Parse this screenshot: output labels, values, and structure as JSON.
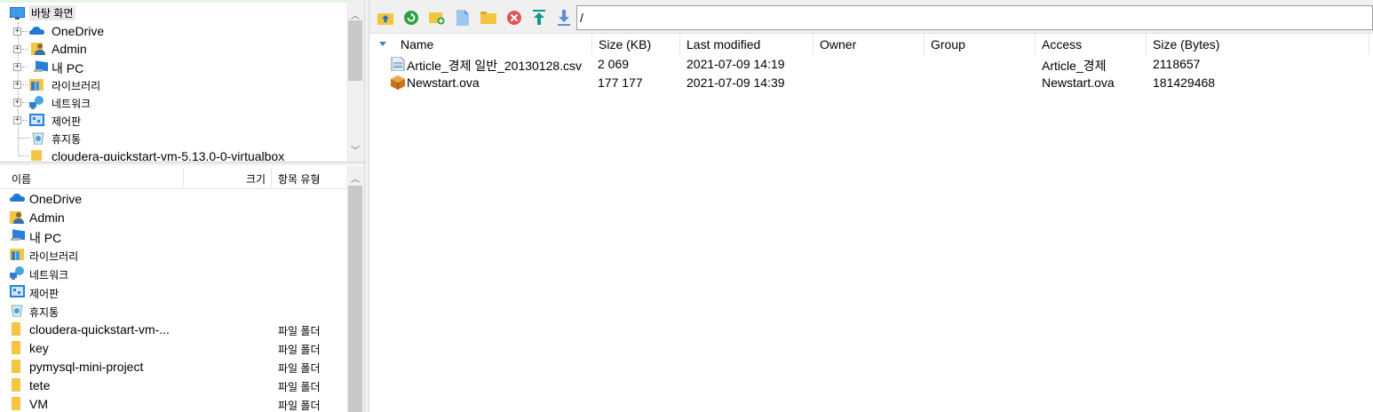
{
  "tree": {
    "root_label": "바탕 화면",
    "items": [
      {
        "label": "OneDrive",
        "icon": "onedrive-cloud-icon"
      },
      {
        "label": "Admin",
        "icon": "user-folder-icon"
      },
      {
        "label": "내 PC",
        "icon": "computer-icon"
      },
      {
        "label": "라이브러리",
        "icon": "library-icon"
      },
      {
        "label": "네트워크",
        "icon": "network-icon"
      },
      {
        "label": "제어판",
        "icon": "control-panel-icon"
      },
      {
        "label": "휴지통",
        "icon": "recycle-bin-icon"
      },
      {
        "label": "cloudera-quickstart-vm-5.13.0-0-virtualbox",
        "icon": "folder-icon"
      }
    ]
  },
  "file_list": {
    "columns": {
      "name": "이름",
      "size": "크기",
      "type": "항목 유형"
    },
    "rows": [
      {
        "name": "OneDrive",
        "type": "",
        "icon": "onedrive-cloud-icon"
      },
      {
        "name": "Admin",
        "type": "",
        "icon": "user-folder-icon"
      },
      {
        "name": "내 PC",
        "type": "",
        "icon": "computer-icon"
      },
      {
        "name": "라이브러리",
        "type": "",
        "icon": "library-icon"
      },
      {
        "name": "네트워크",
        "type": "",
        "icon": "network-icon"
      },
      {
        "name": "제어판",
        "type": "",
        "icon": "control-panel-icon"
      },
      {
        "name": "휴지통",
        "type": "",
        "icon": "recycle-bin-icon"
      },
      {
        "name": "cloudera-quickstart-vm-...",
        "type": "파일 폴더",
        "icon": "folder-icon"
      },
      {
        "name": "key",
        "type": "파일 폴더",
        "icon": "folder-icon"
      },
      {
        "name": "pymysql-mini-project",
        "type": "파일 폴더",
        "icon": "folder-icon"
      },
      {
        "name": "tete",
        "type": "파일 폴더",
        "icon": "folder-icon"
      },
      {
        "name": "VM",
        "type": "파일 폴더",
        "icon": "folder-icon"
      }
    ]
  },
  "toolbar": {
    "buttons": [
      "parent-directory-icon",
      "refresh-icon",
      "new-folder-icon",
      "new-file-icon",
      "open-folder-icon",
      "delete-icon",
      "upload-icon",
      "download-icon"
    ],
    "path": "/"
  },
  "remote": {
    "columns": {
      "name": "Name",
      "size_kb": "Size (KB)",
      "last_modified": "Last modified",
      "owner": "Owner",
      "group": "Group",
      "access": "Access",
      "size_bytes": "Size (Bytes)"
    },
    "files": [
      {
        "name": "Article_경제 일반_20130128.csv",
        "size_kb": "2 069",
        "last_modified": "2021-07-09 14:19",
        "owner": "",
        "group": "",
        "access": "Article_경제",
        "size_bytes": "2118657",
        "icon": "csv-file-icon"
      },
      {
        "name": "Newstart.ova",
        "size_kb": "177 177",
        "last_modified": "2021-07-09 14:39",
        "owner": "",
        "group": "",
        "access": "Newstart.ova",
        "size_bytes": "181429468",
        "icon": "ova-package-icon"
      }
    ]
  },
  "colors": {
    "folder": "#f4c542",
    "onedrive": "#1e78d4",
    "refresh": "#2ea043",
    "delete": "#e05555",
    "upload": "#0a9a8a",
    "download": "#5a8fd8"
  }
}
